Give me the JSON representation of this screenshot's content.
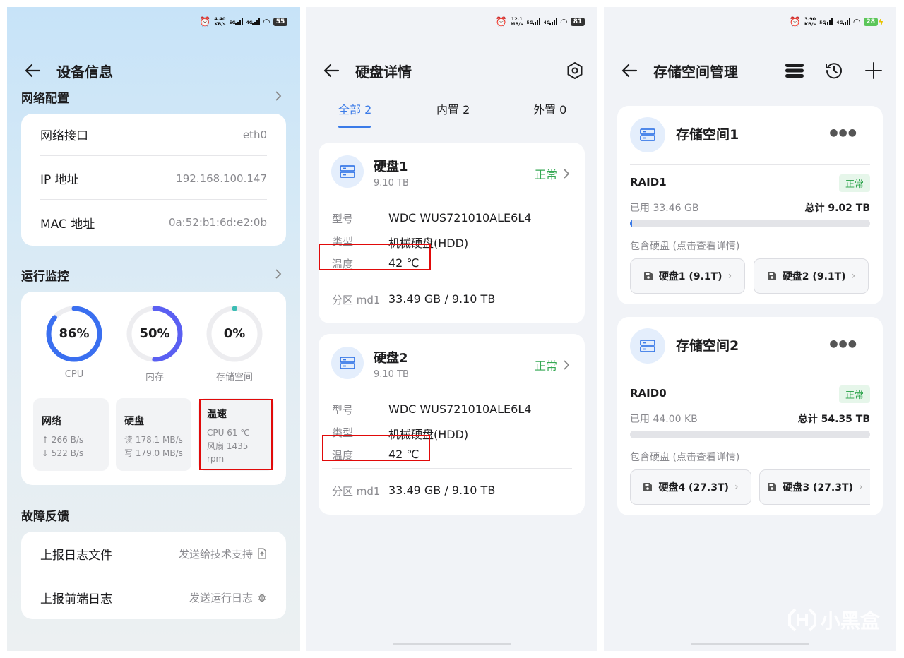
{
  "status_bars": [
    {
      "speed": "4.40\nKB/s",
      "battery": "55",
      "charging": false
    },
    {
      "speed": "12.1\nMB/s",
      "battery": "81",
      "charging": false
    },
    {
      "speed": "3.90\nKB/s",
      "battery": "28",
      "charging": true
    }
  ],
  "device_info": {
    "title": "设备信息",
    "network_section": "网络配置",
    "network_rows": [
      {
        "label": "网络接口",
        "value": "eth0"
      },
      {
        "label": "IP 地址",
        "value": "192.168.100.147"
      },
      {
        "label": "MAC 地址",
        "value": "0a:52:b1:6d:e2:0b"
      }
    ],
    "monitor_section": "运行监控",
    "gauges": [
      {
        "value": "86%",
        "label": "CPU",
        "percent": 86,
        "color": "#3a6ff0"
      },
      {
        "value": "50%",
        "label": "内存",
        "percent": 50,
        "color": "#5a5ff2"
      },
      {
        "value": "0%",
        "label": "存储空间",
        "percent": 0,
        "color": "#3bbdb4"
      }
    ],
    "minis": [
      {
        "title": "网络",
        "lines": [
          "↑ 266 B/s",
          "↓ 522 B/s"
        ]
      },
      {
        "title": "硬盘",
        "lines": [
          "读 178.1 MB/s",
          "写 179.0 MB/s"
        ]
      },
      {
        "title": "温速",
        "lines": [
          "CPU 61 ℃",
          "风扇 1435",
          "rpm"
        ]
      }
    ],
    "feedback_section": "故障反馈",
    "feedback_rows": [
      {
        "label": "上报日志文件",
        "value": "发送给技术支持"
      },
      {
        "label": "上报前端日志",
        "value": "发送运行日志"
      }
    ]
  },
  "disk_details": {
    "title": "硬盘详情",
    "tabs": [
      {
        "label": "全部 2",
        "active": true
      },
      {
        "label": "内置 2",
        "active": false
      },
      {
        "label": "外置 0",
        "active": false
      }
    ],
    "disks": [
      {
        "name": "硬盘1",
        "size": "9.10 TB",
        "status": "正常",
        "model_k": "型号",
        "model": "WDC WUS721010ALE6L4",
        "type_k": "类型",
        "type": "机械硬盘(HDD)",
        "temp_k": "温度",
        "temp": "42 ℃",
        "part_k": "分区 md1",
        "part": "33.49 GB / 9.10 TB"
      },
      {
        "name": "硬盘2",
        "size": "9.10 TB",
        "status": "正常",
        "model_k": "型号",
        "model": "WDC WUS721010ALE6L4",
        "type_k": "类型",
        "type": "机械硬盘(HDD)",
        "temp_k": "温度",
        "temp": "42 ℃",
        "part_k": "分区 md1",
        "part": "33.49 GB / 9.10 TB"
      }
    ]
  },
  "storage": {
    "title": "存储空间管理",
    "spaces": [
      {
        "name": "存储空间1",
        "raid": "RAID1",
        "status": "正常",
        "used": "已用 33.46 GB",
        "total": "总计 9.02 TB",
        "fill": 0.4,
        "include": "包含硬盘 (点击查看详情)",
        "chips": [
          "硬盘1 (9.1T)",
          "硬盘2 (9.1T)"
        ]
      },
      {
        "name": "存储空间2",
        "raid": "RAID0",
        "status": "正常",
        "used": "已用 44.00 KB",
        "total": "总计 54.35 TB",
        "fill": 0,
        "include": "包含硬盘 (点击查看详情)",
        "chips": [
          "硬盘4 (27.3T)",
          "硬盘3 (27.3T)"
        ]
      }
    ]
  },
  "watermark": "小黑盒",
  "colors": {
    "accent": "#3b7be8",
    "ok": "#35a853",
    "highlight": "#e10a0a"
  }
}
